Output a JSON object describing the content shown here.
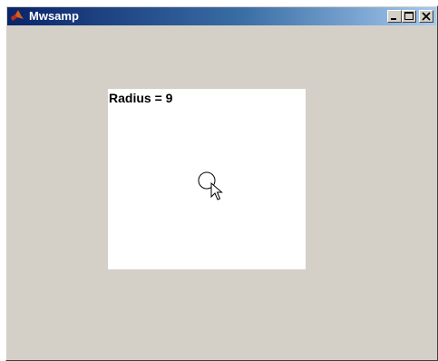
{
  "window": {
    "title": "Mwsamp",
    "title_icon": "matlab-logo-icon",
    "controls": {
      "minimize_icon": "minimize-icon",
      "maximize_icon": "maximize-icon",
      "close_icon": "close-icon"
    },
    "colors": {
      "face": "#d4d0c8",
      "title_start": "#0a246a",
      "title_end": "#a6caf0",
      "canvas": "#ffffff"
    }
  },
  "canvas": {
    "radius_label": "Radius = 9",
    "radius": 9,
    "cursor_icon": "arrow-cursor-icon"
  }
}
